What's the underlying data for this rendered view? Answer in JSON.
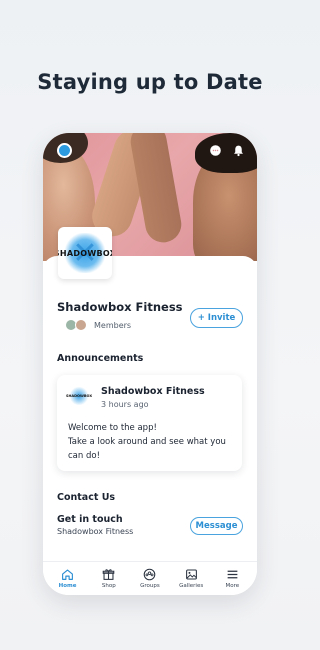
{
  "headline": "Staying up to Date",
  "logo_text": "SHADOWBOX",
  "org": {
    "name": "Shadowbox Fitness",
    "members_label": "Members",
    "invite_label": "+ Invite"
  },
  "announcements": {
    "title": "Announcements",
    "card": {
      "author": "Shadowbox Fitness",
      "time": "3 hours ago",
      "body_line1": "Welcome to the app!",
      "body_line2": "Take a look around and see what you can do!"
    }
  },
  "contact": {
    "title": "Contact Us",
    "get_in_touch": "Get in touch",
    "subtitle": "Shadowbox Fitness",
    "message_label": "Message"
  },
  "tabs": [
    {
      "label": "Home",
      "icon": "home-icon",
      "active": true
    },
    {
      "label": "Shop",
      "icon": "gift-icon",
      "active": false
    },
    {
      "label": "Groups",
      "icon": "groups-icon",
      "active": false
    },
    {
      "label": "Galleries",
      "icon": "image-icon",
      "active": false
    },
    {
      "label": "More",
      "icon": "menu-icon",
      "active": false
    }
  ],
  "colors": {
    "accent": "#2d8fd3",
    "hero": "#e0949a"
  }
}
